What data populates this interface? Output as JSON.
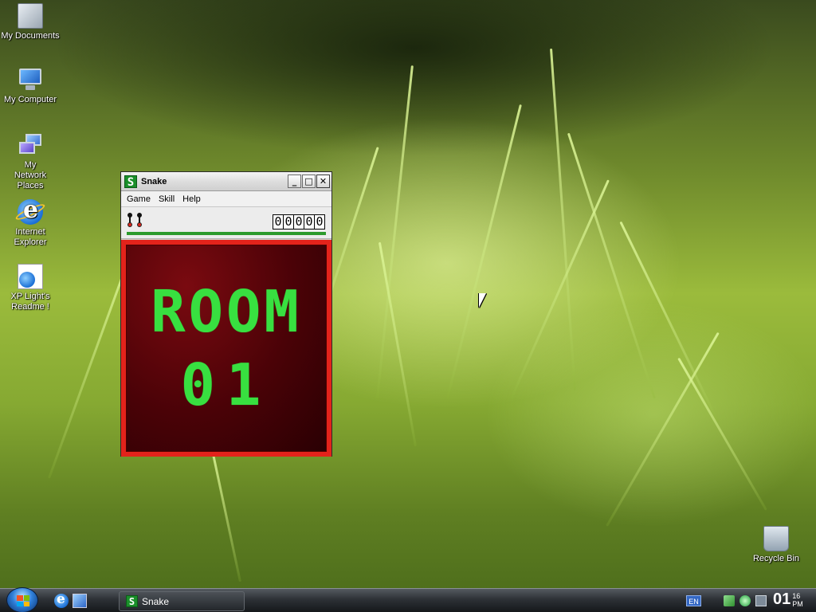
{
  "desktop": {
    "icons": [
      {
        "label": "My Documents",
        "icon": "my-documents-icon"
      },
      {
        "label": "My Computer",
        "icon": "my-computer-icon"
      },
      {
        "label": "My Network Places",
        "icon": "network-places-icon"
      },
      {
        "label": "Internet Explorer",
        "icon": "internet-explorer-icon"
      },
      {
        "label": "XP Light's Readme !",
        "icon": "readme-icon"
      },
      {
        "label": "Recycle Bin",
        "icon": "recycle-bin-icon"
      }
    ]
  },
  "window": {
    "logo_letter": "S",
    "title": "Snake",
    "controls": {
      "minimize": "_",
      "maximize": "□",
      "close": "✕"
    },
    "menu": [
      "Game",
      "Skill",
      "Help"
    ],
    "lives": 2,
    "score_digits": [
      "0",
      "0",
      "0",
      "0",
      "0"
    ],
    "progress_fraction": 1.0,
    "banner_line1": "ROOM",
    "banner_line2": "01",
    "colors": {
      "board_border": "#e3231b",
      "text": "#38e040",
      "board_bg": "#4a0207"
    }
  },
  "taskbar": {
    "task_label": "Snake",
    "task_logo_letter": "S",
    "language": "EN",
    "clock_hour": "01",
    "clock_minute": "16",
    "clock_ampm": "PM"
  }
}
